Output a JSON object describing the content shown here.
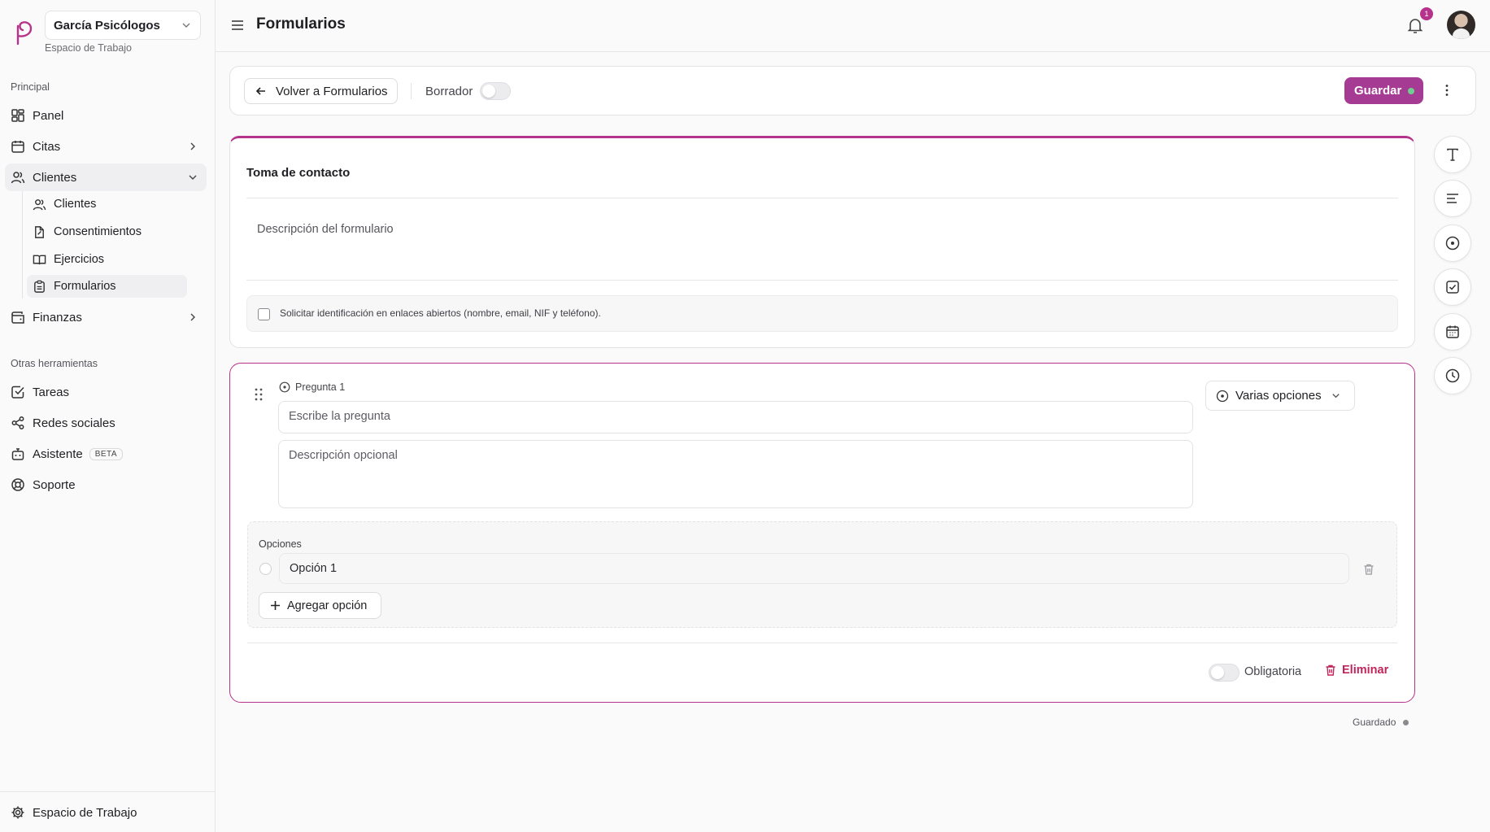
{
  "workspace": {
    "name": "García Psicólogos",
    "subtitle": "Espacio de Trabajo"
  },
  "sidebar": {
    "section_main": "Principal",
    "items": {
      "panel": "Panel",
      "citas": "Citas",
      "clientes": "Clientes",
      "finanzas": "Finanzas"
    },
    "clientes_sub": {
      "clientes": "Clientes",
      "consentimientos": "Consentimientos",
      "ejercicios": "Ejercicios",
      "formularios": "Formularios"
    },
    "section_other": "Otras herramientas",
    "other": {
      "tareas": "Tareas",
      "redes": "Redes sociales",
      "asistente": "Asistente",
      "asistente_badge": "BETA",
      "soporte": "Soporte"
    },
    "footer": "Espacio de Trabajo"
  },
  "header": {
    "title": "Formularios",
    "notifications": "1"
  },
  "toolbar": {
    "back": "Volver a Formularios",
    "draft": "Borrador",
    "save": "Guardar"
  },
  "form": {
    "title": "Toma de contacto",
    "description_placeholder": "Descripción del formulario",
    "id_request": "Solicitar identificación en enlaces abiertos (nombre, email, NIF y teléfono)."
  },
  "question": {
    "label": "Pregunta 1",
    "placeholder": "Escribe la pregunta",
    "description_placeholder": "Descripción opcional",
    "type": "Varias opciones",
    "options_label": "Opciones",
    "options": [
      "Opción 1"
    ],
    "add_option": "Agregar opción",
    "required": "Obligatoria",
    "delete": "Eliminar"
  },
  "status": {
    "saved": "Guardado"
  },
  "colors": {
    "accent": "#b5338a",
    "danger": "#c0245b"
  }
}
